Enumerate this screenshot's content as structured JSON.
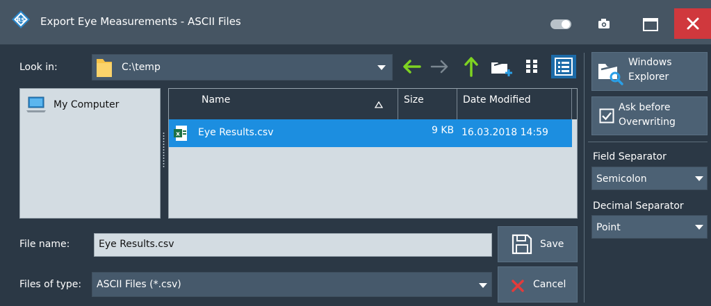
{
  "window": {
    "title": "Export Eye Measurements - ASCII Files"
  },
  "look_in": {
    "label": "Look in:",
    "value": "C:\\temp"
  },
  "places": {
    "items": [
      {
        "label": "My Computer",
        "icon": "computer-icon"
      }
    ]
  },
  "file_list": {
    "columns": [
      {
        "label": "Name",
        "sorted": "ascending"
      },
      {
        "label": "Size"
      },
      {
        "label": "Date Modified"
      }
    ],
    "rows": [
      {
        "name": "Eye Results.csv",
        "size": "9 KB",
        "modified": "16.03.2018 14:59",
        "icon": "excel-file-icon",
        "selected": true
      }
    ]
  },
  "file_name": {
    "label": "File name:",
    "value": "Eye Results.csv"
  },
  "file_type": {
    "label": "Files of type:",
    "value": "ASCII Files (*.csv)"
  },
  "buttons": {
    "save": "Save",
    "cancel": "Cancel",
    "windows_explorer_line1": "Windows",
    "windows_explorer_line2": "Explorer",
    "ask_line1": "Ask before",
    "ask_line2": "Overwriting"
  },
  "ask_before_overwriting": {
    "checked": true
  },
  "field_separator": {
    "label": "Field Separator",
    "value": "Semicolon"
  },
  "decimal_separator": {
    "label": "Decimal Separator",
    "value": "Point"
  },
  "colors": {
    "background": "#2b3845",
    "titlebar": "#465563",
    "accent_selection": "#1c8ee0",
    "close_button": "#d0383d",
    "nav_arrow_green": "#7ed321"
  }
}
